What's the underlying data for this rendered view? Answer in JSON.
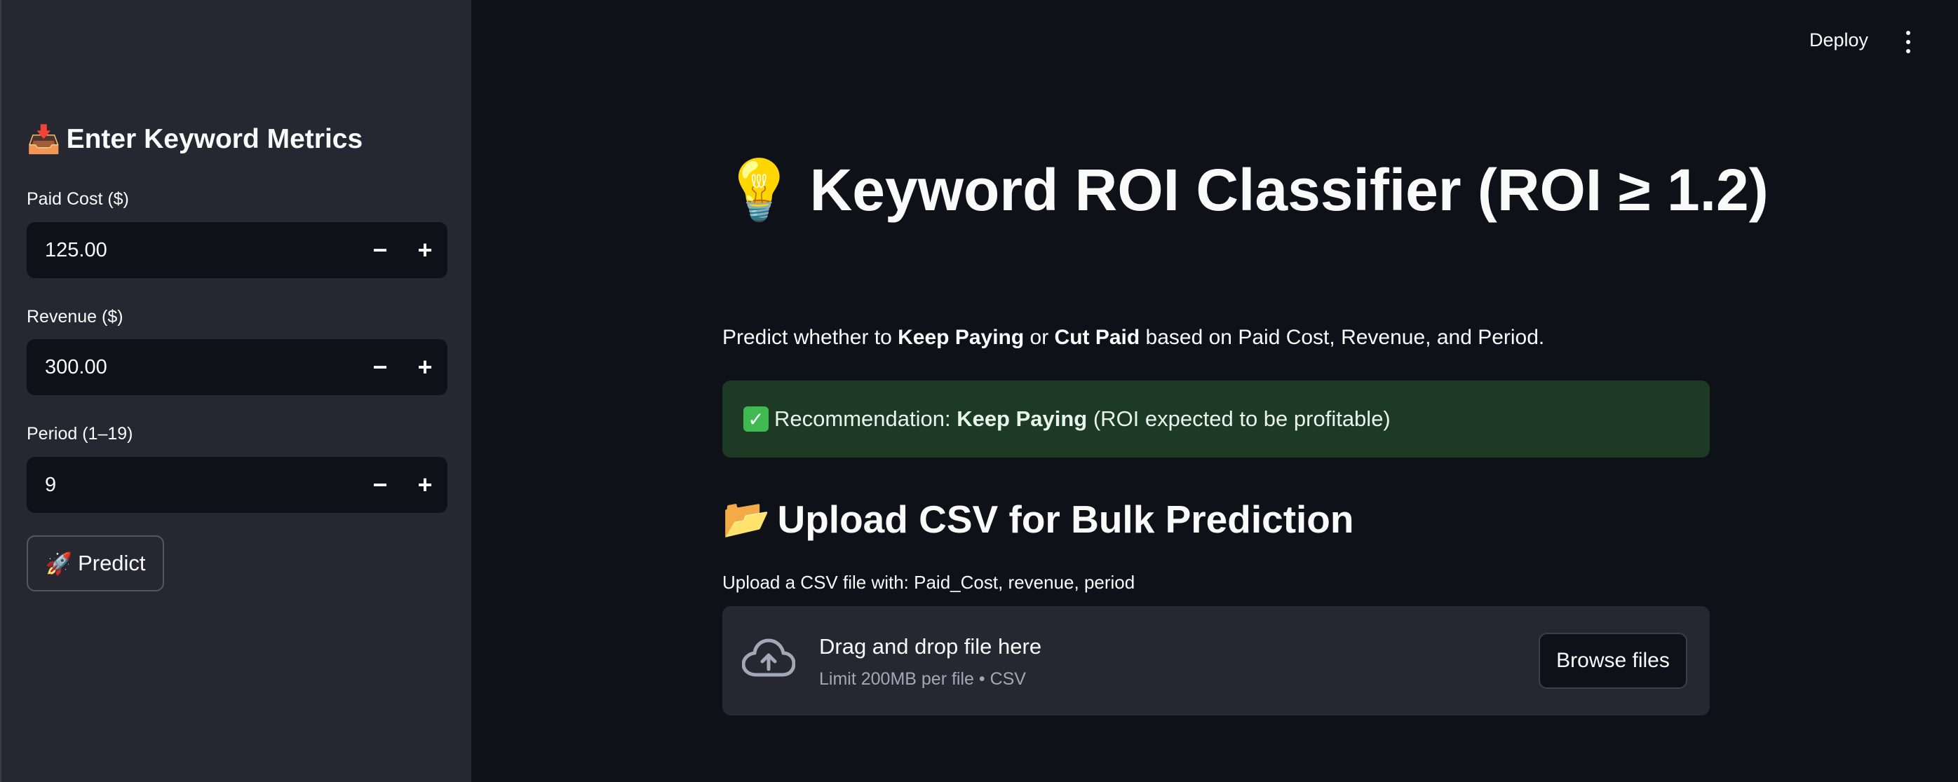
{
  "header": {
    "deploy_label": "Deploy",
    "menu_icon": "more-vertical-icon"
  },
  "sidebar": {
    "title_emoji": "📥",
    "title": "Enter Keyword Metrics",
    "fields": [
      {
        "label": "Paid Cost ($)",
        "value": "125.00"
      },
      {
        "label": "Revenue ($)",
        "value": "300.00"
      },
      {
        "label": "Period (1–19)",
        "value": "9"
      }
    ],
    "stepper_minus": "−",
    "stepper_plus": "+",
    "predict_emoji": "🚀",
    "predict_label": "Predict"
  },
  "main": {
    "title_emoji": "💡",
    "title": "Keyword ROI Classifier (ROI ≥ 1.2)",
    "description": {
      "prefix": "Predict whether to ",
      "option1": "Keep Paying",
      "middle": " or ",
      "option2": "Cut Paid",
      "suffix": " based on Paid Cost, Revenue, and Period."
    },
    "result": {
      "check": "✓",
      "prefix": "Recommendation: ",
      "decision": "Keep Paying",
      "suffix": " (ROI expected to be profitable)",
      "color": "#1d3a25"
    },
    "upload": {
      "title_emoji": "📂",
      "title": "Upload CSV for Bulk Prediction",
      "label": "Upload a CSV file with: Paid_Cost, revenue, period",
      "drop_text": "Drag and drop file here",
      "limit_text": "Limit 200MB per file • CSV",
      "browse_label": "Browse files"
    }
  }
}
